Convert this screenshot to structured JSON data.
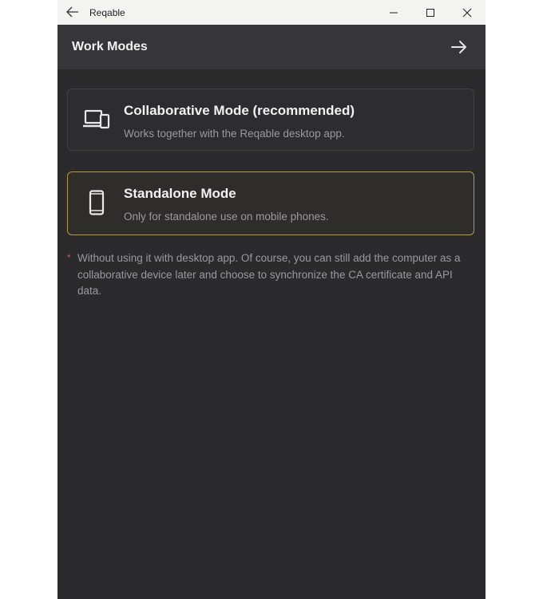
{
  "window": {
    "app_title": "Reqable",
    "controls": [
      "minimize-icon",
      "maximize-icon",
      "close-icon"
    ]
  },
  "header": {
    "title": "Work Modes",
    "next_icon": "arrow-right-icon"
  },
  "modes": {
    "collaborative": {
      "title": "Collaborative Mode (recommended)",
      "description": "Works together with the Reqable desktop app.",
      "icon": "devices-icon",
      "selected": false
    },
    "standalone": {
      "title": "Standalone Mode",
      "description": "Only for standalone use on mobile phones.",
      "icon": "smartphone-icon",
      "selected": true
    }
  },
  "note": {
    "marker": "*",
    "text": "Without using it with desktop app. Of course, you can still add the computer as a collaborative device later and choose to synchronize the CA certificate and API data."
  },
  "colors": {
    "background": "#2b2a2d",
    "header": "#363539",
    "selected_border": "#b89a3b",
    "note_marker": "#c9584f"
  }
}
